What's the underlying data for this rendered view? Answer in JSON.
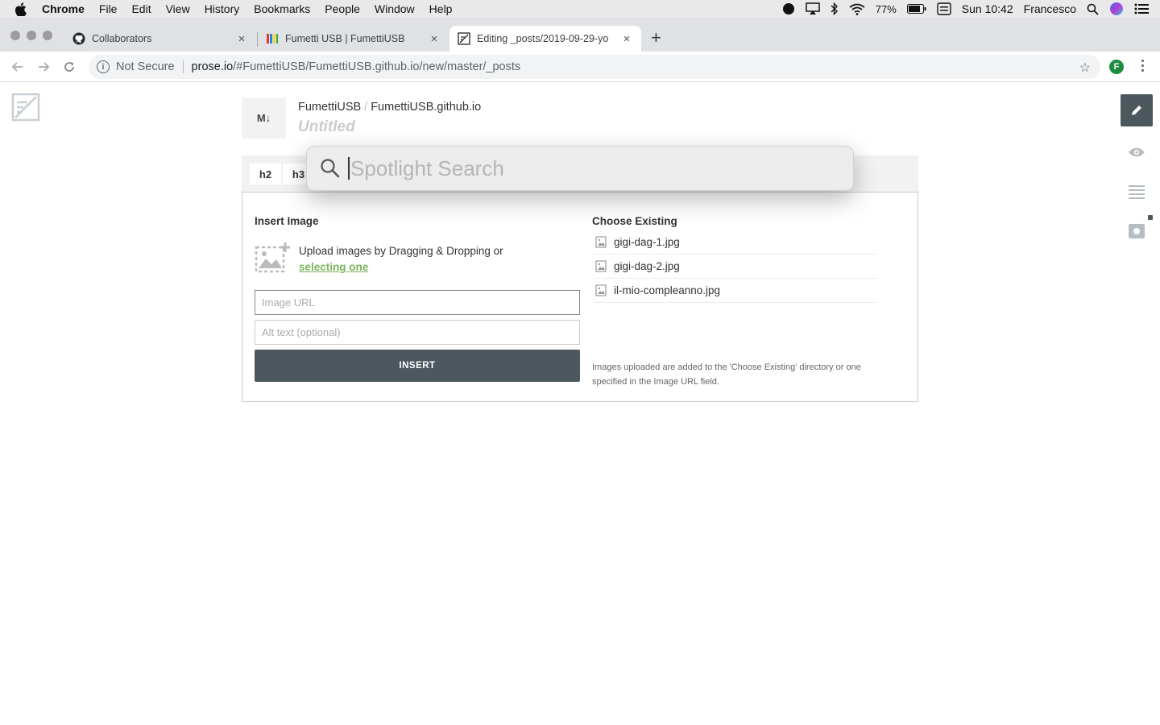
{
  "menubar": {
    "app": "Chrome",
    "items": [
      "File",
      "Edit",
      "View",
      "History",
      "Bookmarks",
      "People",
      "Window",
      "Help"
    ],
    "battery": "77%",
    "clock": "Sun 10:42",
    "user": "Francesco"
  },
  "tabs": [
    {
      "title": "Collaborators",
      "icon": "github-icon"
    },
    {
      "title": "Fumetti USB | FumettiUSB",
      "icon": "fumetti-favicon"
    },
    {
      "title": "Editing _posts/2019-09-29-yo",
      "icon": "prose-favicon"
    }
  ],
  "omnibox": {
    "security": "Not Secure",
    "host": "prose.io",
    "path": "/#FumettiUSB/FumettiUSB.github.io/new/master/_posts",
    "profile_initial": "F"
  },
  "editor": {
    "file_type": "M↓",
    "breadcrumb": {
      "owner": "FumettiUSB",
      "separator": "/",
      "repo": "FumettiUSB.github.io"
    },
    "title": "Untitled",
    "format_buttons": [
      "h2",
      "h3"
    ]
  },
  "insert_image": {
    "heading": "Insert Image",
    "upload_text": "Upload images by Dragging & Dropping or",
    "upload_link": "selecting one",
    "url_placeholder": "Image URL",
    "alt_placeholder": "Alt text (optional)",
    "insert_label": "INSERT",
    "existing_heading": "Choose Existing",
    "existing_files": [
      "gigi-dag-1.jpg",
      "gigi-dag-2.jpg",
      "il-mio-compleanno.jpg"
    ],
    "note": "Images uploaded are added to the 'Choose Existing' directory or one specified in the Image URL field."
  },
  "spotlight": {
    "placeholder": "Spotlight Search"
  },
  "colors": {
    "accent_dark": "#4c575e",
    "link_green": "#7ab55c",
    "profile_green": "#1e8e3e"
  }
}
